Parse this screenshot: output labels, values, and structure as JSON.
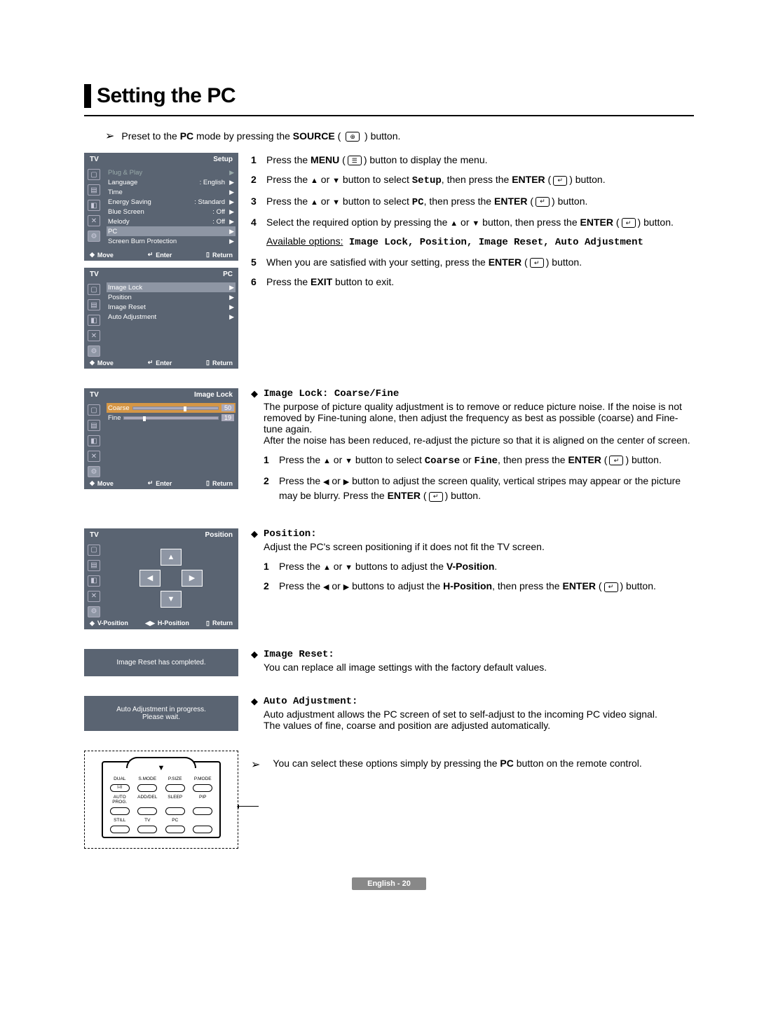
{
  "title": "Setting the PC",
  "preset_text_before": "Preset to the ",
  "preset_pc": "PC",
  "preset_text_mid": " mode by pressing the ",
  "preset_source": "SOURCE",
  "preset_paren": " (",
  "preset_close": ") button.",
  "osd1": {
    "left": "TV",
    "right": "Setup",
    "rows": [
      {
        "label": "Plug & Play",
        "val": "",
        "cls": "dim"
      },
      {
        "label": "Language",
        "val": ": English"
      },
      {
        "label": "Time",
        "val": ""
      },
      {
        "label": "Energy Saving",
        "val": ": Standard"
      },
      {
        "label": "Blue Screen",
        "val": ": Off"
      },
      {
        "label": "Melody",
        "val": ": Off"
      },
      {
        "label": "PC",
        "val": "",
        "cls": "hl"
      },
      {
        "label": "Screen Burn Protection",
        "val": ""
      }
    ],
    "footer": {
      "move": "Move",
      "enter": "Enter",
      "return": "Return"
    }
  },
  "osd2": {
    "left": "TV",
    "right": "PC",
    "rows": [
      {
        "label": "Image Lock",
        "val": "",
        "cls": "hl"
      },
      {
        "label": "Position",
        "val": ""
      },
      {
        "label": "Image Reset",
        "val": ""
      },
      {
        "label": "Auto Adjustment",
        "val": ""
      }
    ],
    "footer": {
      "move": "Move",
      "enter": "Enter",
      "return": "Return"
    }
  },
  "osd3": {
    "left": "TV",
    "right": "Image Lock",
    "rows": [
      {
        "label": "Coarse",
        "val": "50",
        "thumb": 60,
        "cls": "hl-orange"
      },
      {
        "label": "Fine",
        "val": "19",
        "thumb": 20
      }
    ],
    "footer": {
      "move": "Move",
      "enter": "Enter",
      "return": "Return"
    }
  },
  "osd4": {
    "left": "TV",
    "right": "Position",
    "footer": {
      "vpos": "V-Position",
      "hpos": "H-Position",
      "return": "Return"
    }
  },
  "msg1": "Image Reset has completed.",
  "msg2_l1": "Auto Adjustment in progress.",
  "msg2_l2": "Please wait.",
  "steps_main": [
    {
      "n": "1",
      "parts": [
        "Press the ",
        {
          "b": "MENU"
        },
        " (",
        {
          "icon": "menu"
        },
        ") button to display the menu."
      ]
    },
    {
      "n": "2",
      "parts": [
        "Press the ",
        {
          "tri": "▲"
        },
        " or ",
        {
          "tri": "▼"
        },
        " button to select ",
        {
          "mono": "Setup"
        },
        ", then press the ",
        {
          "b": "ENTER"
        },
        " (",
        {
          "icon": "enter"
        },
        ") button."
      ]
    },
    {
      "n": "3",
      "parts": [
        "Press the ",
        {
          "tri": "▲"
        },
        " or ",
        {
          "tri": "▼"
        },
        " button to select ",
        {
          "mono": "PC"
        },
        ", then press the ",
        {
          "b": "ENTER"
        },
        " (",
        {
          "icon": "enter"
        },
        ") button."
      ]
    },
    {
      "n": "4",
      "parts": [
        "Select the required option by pressing the ",
        {
          "tri": "▲"
        },
        " or ",
        {
          "tri": "▼"
        },
        " button, then press the ",
        {
          "b": "ENTER"
        },
        " (",
        {
          "icon": "enter"
        },
        ") button."
      ],
      "extra_underline": "Available options:",
      "extra_opts": " Image Lock, Position, Image Reset, Auto Adjustment"
    },
    {
      "n": "5",
      "parts": [
        "When you are satisfied with your setting, press the ",
        {
          "b": "ENTER"
        },
        " (",
        {
          "icon": "enter"
        },
        ") button."
      ]
    },
    {
      "n": "6",
      "parts": [
        "Press the ",
        {
          "b": "EXIT"
        },
        " button to exit."
      ]
    }
  ],
  "sec_imagelock": {
    "head": "Image Lock: Coarse/Fine",
    "p": "The purpose of picture quality adjustment is to remove or reduce picture noise. If the noise is not removed by Fine-tuning alone, then adjust the frequency as best as possible (coarse) and Fine-tune again.\nAfter the noise has been reduced, re-adjust the picture so that it is aligned on the center of screen.",
    "steps": [
      {
        "n": "1",
        "parts": [
          "Press the ",
          {
            "tri": "▲"
          },
          " or ",
          {
            "tri": "▼"
          },
          " button to select ",
          {
            "mono": "Coarse"
          },
          " or ",
          {
            "mono": "Fine"
          },
          ", then press the ",
          {
            "b": "ENTER"
          },
          " (",
          {
            "icon": "enter"
          },
          ") button."
        ]
      },
      {
        "n": "2",
        "parts": [
          "Press the ",
          {
            "tri": "◀"
          },
          " or ",
          {
            "tri": "▶"
          },
          " button to adjust the screen quality, vertical stripes may appear or the picture may be blurry. Press the ",
          {
            "b": "ENTER"
          },
          " (",
          {
            "icon": "enter"
          },
          ") button."
        ]
      }
    ]
  },
  "sec_position": {
    "head": "Position:",
    "p": "Adjust the PC's screen positioning if it does not fit the TV screen.",
    "steps": [
      {
        "n": "1",
        "parts": [
          "Press the ",
          {
            "tri": "▲"
          },
          " or ",
          {
            "tri": "▼"
          },
          " buttons to adjust the ",
          {
            "b": "V-Position"
          },
          "."
        ]
      },
      {
        "n": "2",
        "parts": [
          "Press the ",
          {
            "tri": "◀"
          },
          " or ",
          {
            "tri": "▶"
          },
          " buttons to adjust the ",
          {
            "b": "H-Position"
          },
          ", then press the ",
          {
            "b": "ENTER"
          },
          " (",
          {
            "icon": "enter"
          },
          ") button."
        ]
      }
    ]
  },
  "sec_imagereset": {
    "head": "Image Reset:",
    "p": "You can replace all image settings with the factory default values."
  },
  "sec_auto": {
    "head": "Auto Adjustment:",
    "p": "Auto adjustment allows the PC screen of set to self-adjust to the incoming PC video signal.\nThe values of fine, coarse and position are adjusted automatically."
  },
  "tip_parts": [
    "You can select these options simply by pressing the ",
    {
      "b": "PC"
    },
    " button on the remote control."
  ],
  "remote_labels": [
    "DUAL",
    "S.MODE",
    "P.SIZE",
    "P.MODE",
    "AUTO PROG.",
    "ADD/DEL",
    "SLEEP",
    "PIP",
    "STILL",
    "TV",
    "PC",
    ""
  ],
  "remote_btn_text": [
    "I-II",
    "",
    "",
    "",
    "",
    " ",
    " ",
    " ",
    "",
    "",
    "",
    ""
  ],
  "page_label": "English - 20"
}
